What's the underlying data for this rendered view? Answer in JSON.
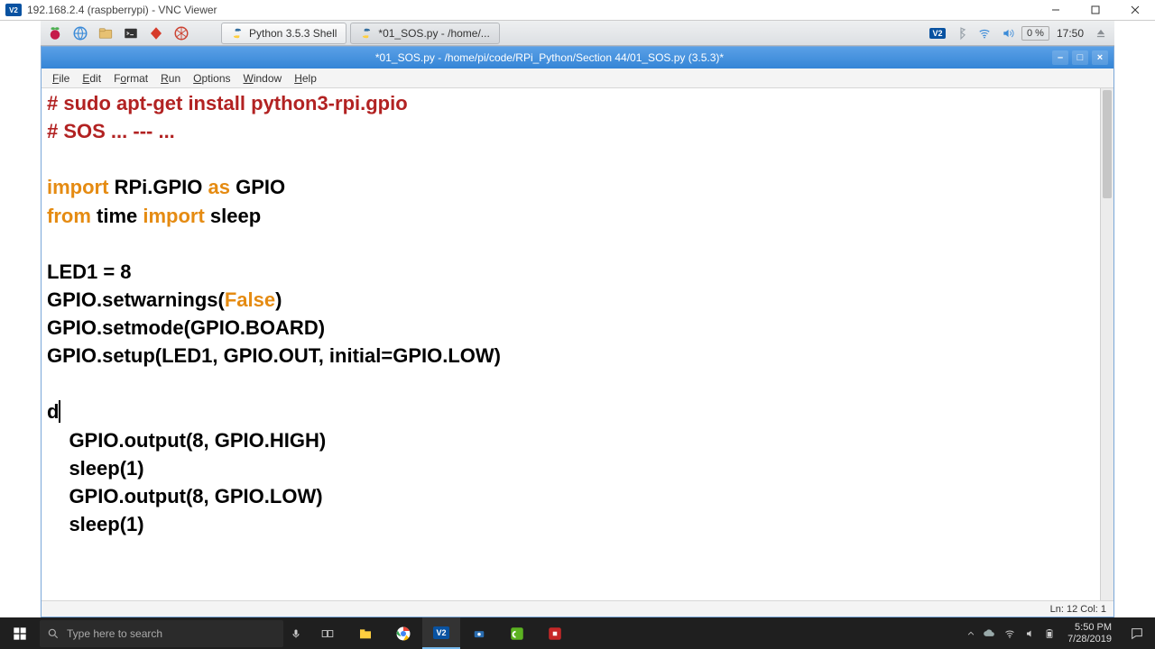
{
  "vnc": {
    "title": "192.168.2.4 (raspberrypi) - VNC Viewer",
    "logo_text": "V2"
  },
  "lxpanel": {
    "task1": "Python 3.5.3 Shell",
    "task2": "*01_SOS.py - /home/...",
    "vc_logo": "V2",
    "percent": "0 %",
    "time": "17:50"
  },
  "idle": {
    "title": "*01_SOS.py - /home/pi/code/RPi_Python/Section 44/01_SOS.py (3.5.3)*",
    "menus": {
      "file": "File",
      "edit": "Edit",
      "format": "Format",
      "run": "Run",
      "options": "Options",
      "window": "Window",
      "help": "Help"
    },
    "status": "Ln: 12  Col: 1",
    "code": {
      "c1": "# sudo apt-get install python3-rpi.gpio",
      "c2": "# SOS ... --- ...",
      "blank": "",
      "import_kw": "import",
      "import_mod": " RPi.GPIO ",
      "as_kw": "as",
      "import_alias": " GPIO",
      "from_kw": "from",
      "from_mod": " time ",
      "import_kw2": "import",
      "sleep": " sleep",
      "l7": "LED1 = 8",
      "l8a": "GPIO.setwarnings(",
      "l8b": "False",
      "l8c": ")",
      "l9": "GPIO.setmode(GPIO.BOARD)",
      "l10": "GPIO.setup(LED1, GPIO.OUT, initial=GPIO.LOW)",
      "l12": "d",
      "l13": "    GPIO.output(8, GPIO.HIGH)",
      "l14": "    sleep(1)",
      "l15": "    GPIO.output(8, GPIO.LOW)",
      "l16": "    sleep(1)"
    }
  },
  "windows": {
    "search_placeholder": "Type here to search",
    "clock_time": "5:50 PM",
    "clock_date": "7/28/2019"
  }
}
